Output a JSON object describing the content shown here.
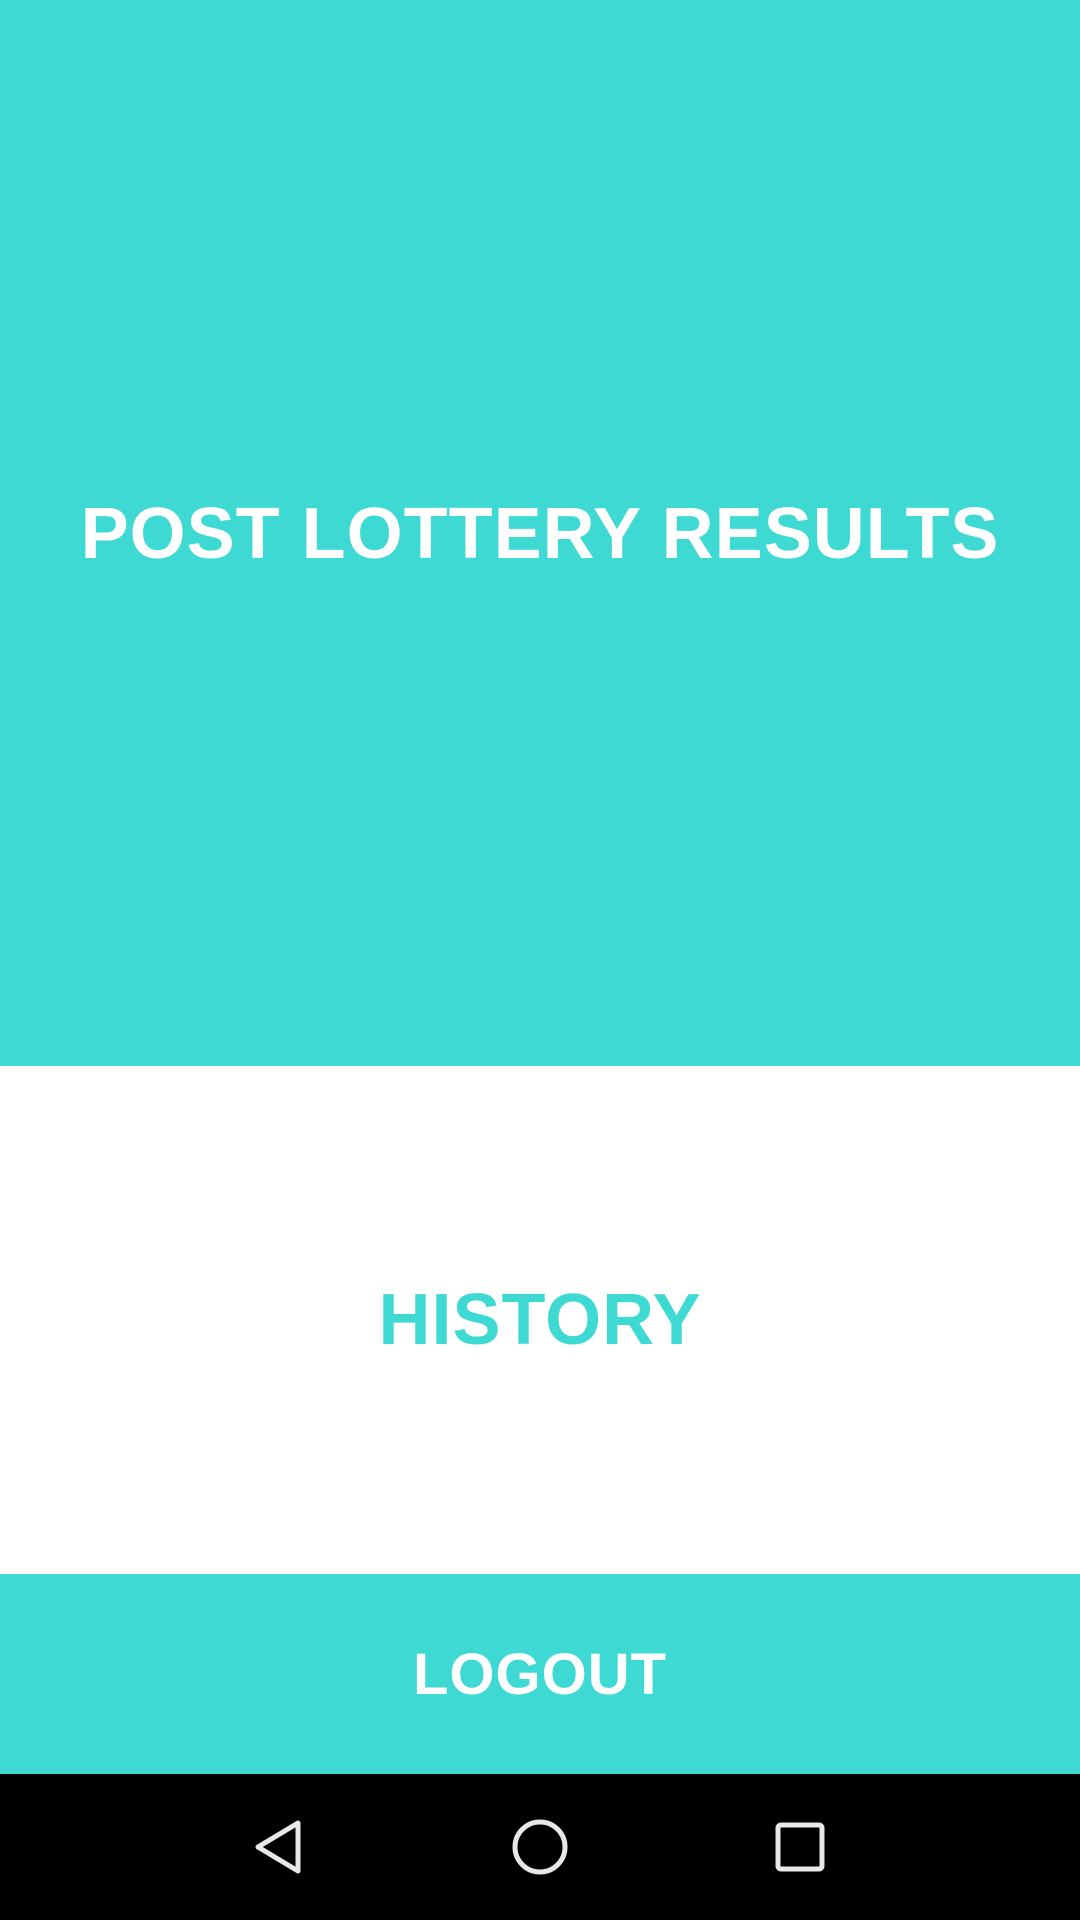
{
  "main": {
    "post_results_label": "POST LOTTERY RESULTS",
    "history_label": "HISTORY",
    "logout_label": "LOGOUT"
  },
  "colors": {
    "accent": "#3ed9d3",
    "background": "#ffffff",
    "navbar": "#000000"
  },
  "navbar": {
    "icons": [
      "back-icon",
      "home-icon",
      "recents-icon"
    ]
  }
}
